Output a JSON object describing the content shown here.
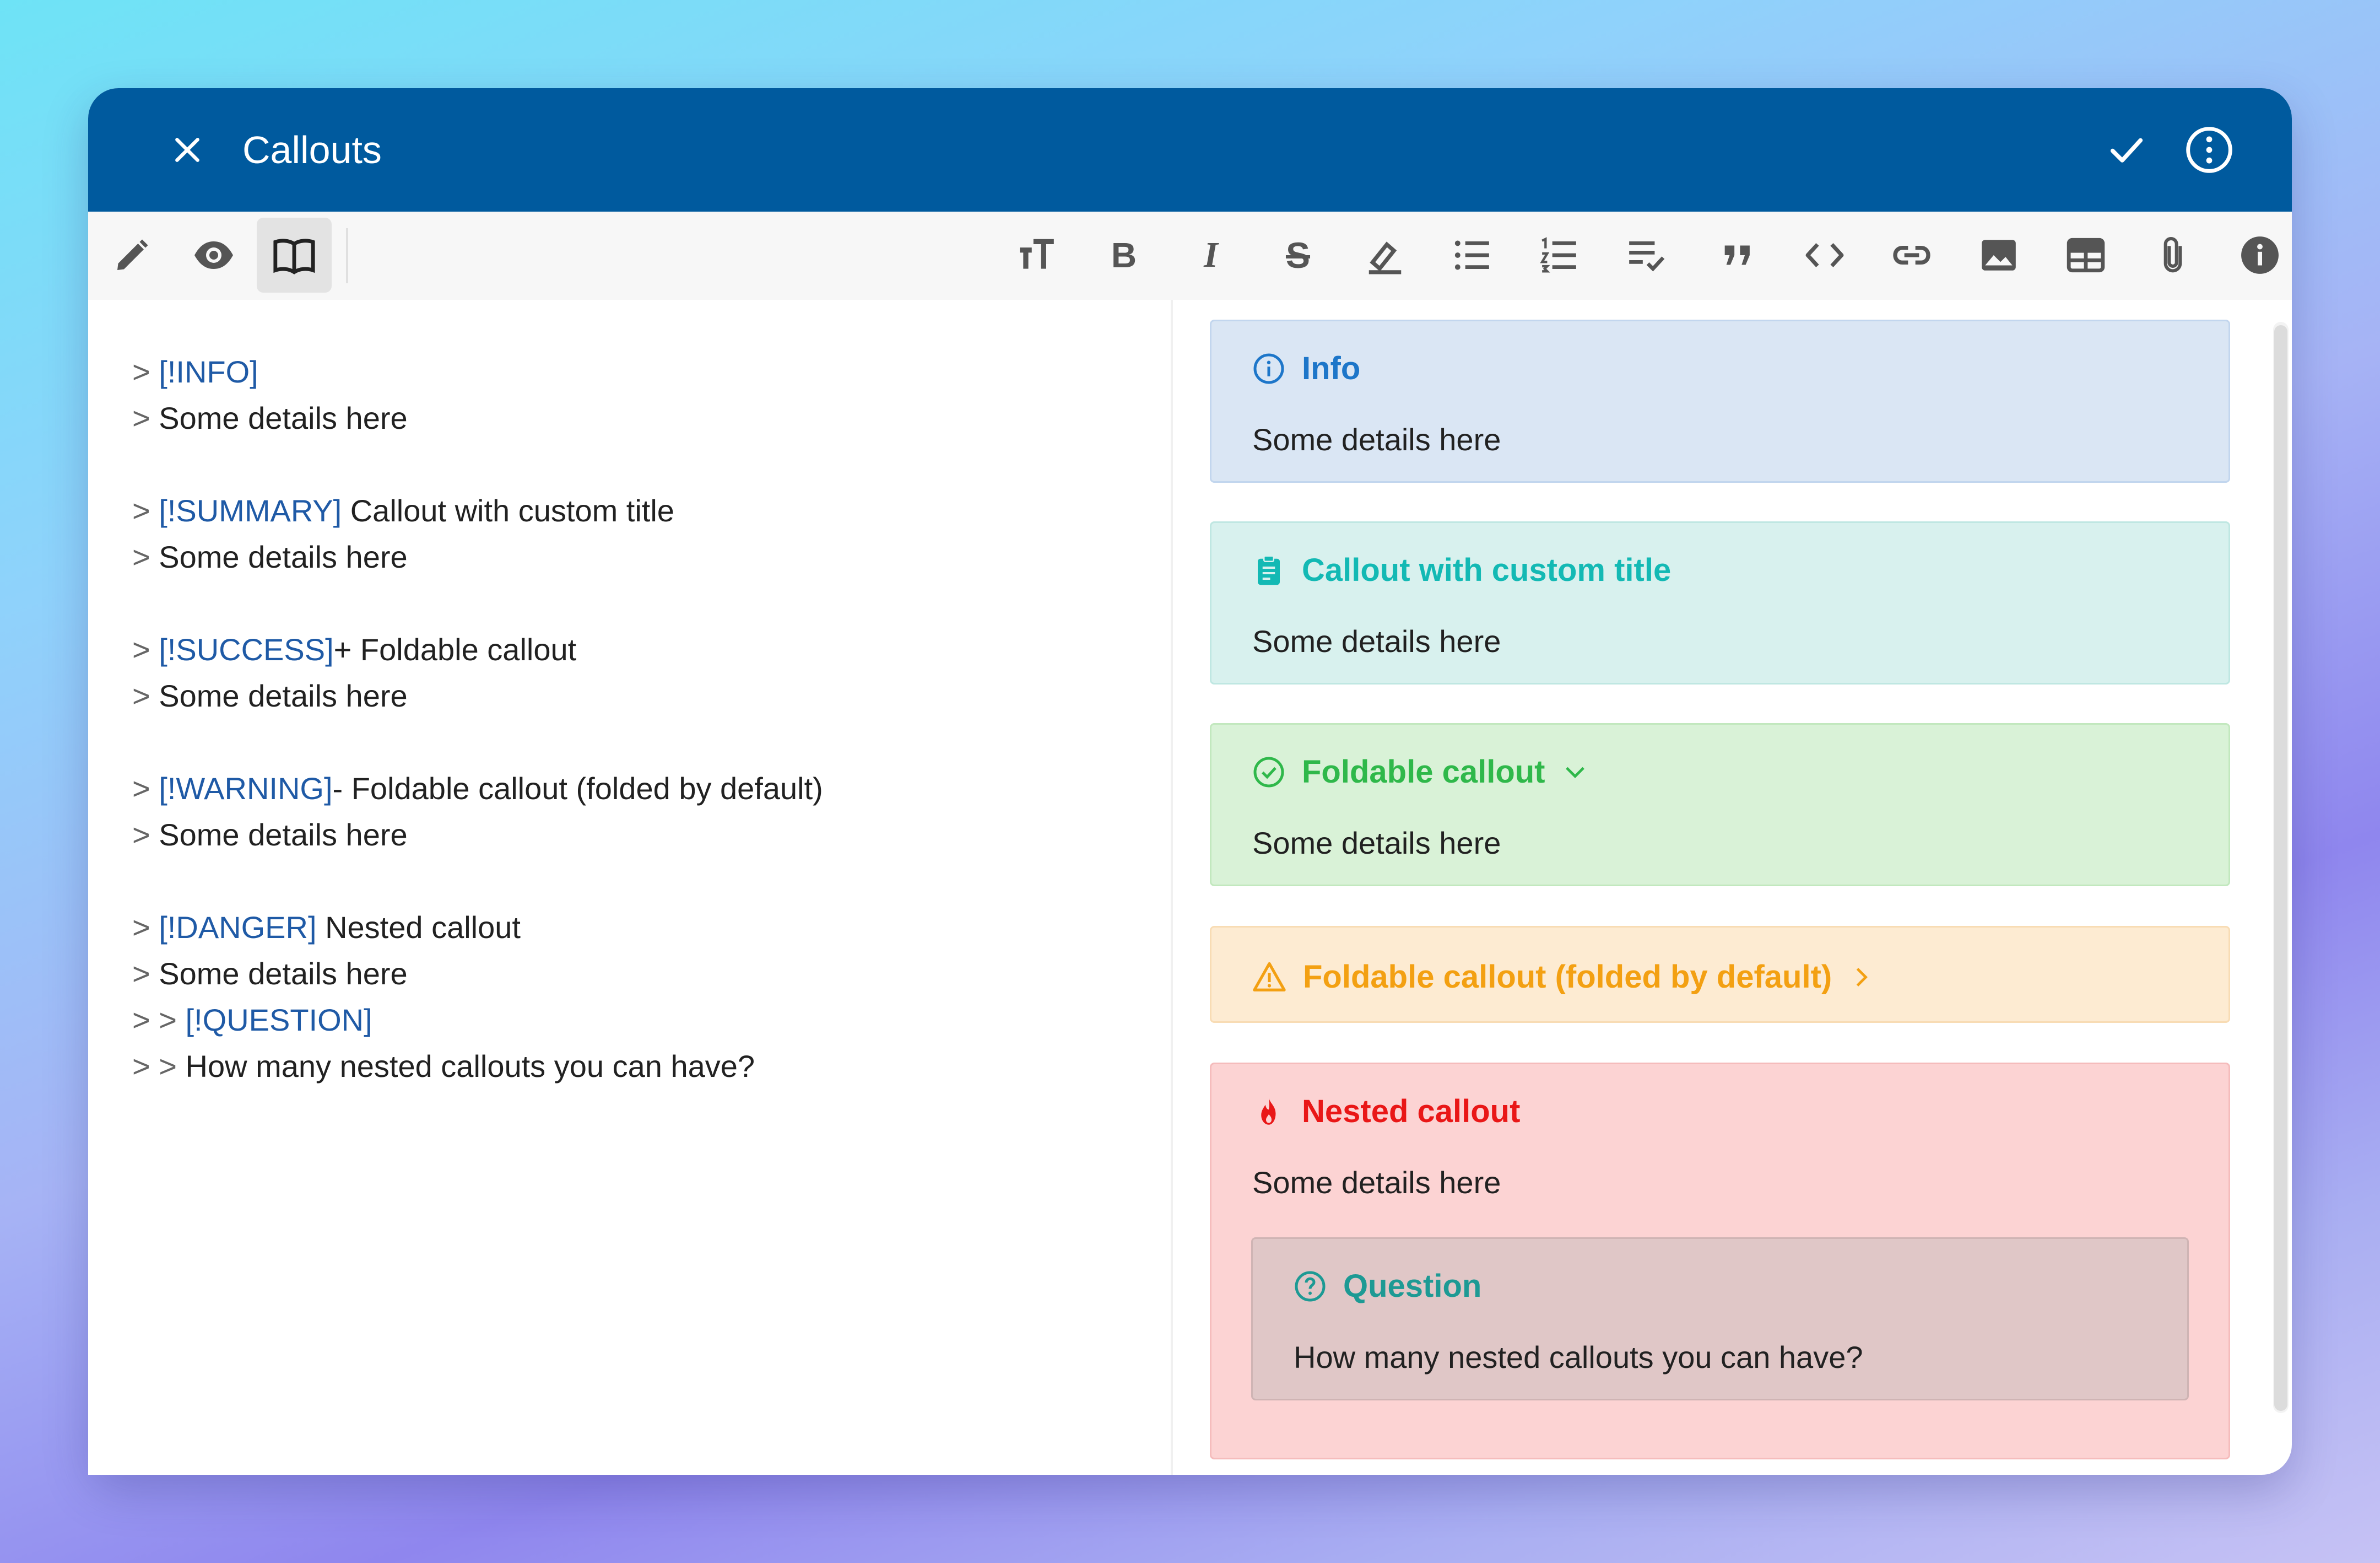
{
  "appbar": {
    "title": "Callouts",
    "close_icon": "close-icon",
    "confirm_icon": "check-icon",
    "more_icon": "more-vertical-circle-icon",
    "color": "#005a9e"
  },
  "toolbar": {
    "mode_buttons": [
      "edit-pencil-icon",
      "preview-eye-icon",
      "reader-book-icon"
    ],
    "format_buttons": [
      "text-size-icon",
      "bold-icon",
      "italic-icon",
      "strikethrough-icon",
      "highlight-icon",
      "bullet-list-icon",
      "numbered-list-icon",
      "task-list-icon",
      "quote-icon",
      "code-icon",
      "link-icon",
      "image-icon",
      "table-icon",
      "attachment-icon",
      "info-icon"
    ],
    "bold_glyph": "B",
    "italic_glyph": "I",
    "strike_glyph": "S"
  },
  "editor": {
    "lines": [
      {
        "prefix": "> ",
        "tag": "[!INFO]",
        "rest": ""
      },
      {
        "prefix": "> ",
        "tag": "",
        "rest": "Some details here"
      },
      {
        "prefix": "> ",
        "tag": "[!SUMMARY]",
        "rest": " Callout with custom title"
      },
      {
        "prefix": "> ",
        "tag": "",
        "rest": "Some details here"
      },
      {
        "prefix": "> ",
        "tag": "[!SUCCESS]",
        "rest": "+ Foldable callout"
      },
      {
        "prefix": "> ",
        "tag": "",
        "rest": "Some details here"
      },
      {
        "prefix": "> ",
        "tag": "[!WARNING]",
        "rest": "- Foldable callout (folded by default)"
      },
      {
        "prefix": "> ",
        "tag": "",
        "rest": "Some details here"
      },
      {
        "prefix": "> ",
        "tag": "[!DANGER]",
        "rest": " Nested callout"
      },
      {
        "prefix": "> ",
        "tag": "",
        "rest": "Some details here"
      },
      {
        "prefix": "> > ",
        "tag": "[!QUESTION]",
        "rest": ""
      },
      {
        "prefix": "> > ",
        "tag": "",
        "rest": "How many nested callouts you can have?"
      }
    ]
  },
  "preview": {
    "info": {
      "title": "Info",
      "body": "Some details here",
      "bg": "#dae6f4",
      "border": "#c2d6ee",
      "color": "#1d76c9"
    },
    "summary": {
      "title": "Callout with custom title",
      "body": "Some details here",
      "bg": "#d8f1ee",
      "border": "#bfe7e2",
      "color": "#13b9b4"
    },
    "success": {
      "title": "Foldable callout",
      "body": "Some details here",
      "bg": "#d9f2d7",
      "border": "#c2e8be",
      "color": "#2fb84a"
    },
    "warning": {
      "title": "Foldable callout (folded by default)",
      "bg": "#fdebd2",
      "border": "#f8dcb4",
      "color": "#f3a012"
    },
    "danger": {
      "title": "Nested callout",
      "body": "Some details here",
      "bg": "#fcd3d3",
      "border": "#f5bcbc",
      "color": "#e91717"
    },
    "question": {
      "title": "Question",
      "body": "How many nested callouts you can have?",
      "bg": "#e0c7c7",
      "border": "#cfb4b4",
      "color": "#1d9a94"
    }
  }
}
